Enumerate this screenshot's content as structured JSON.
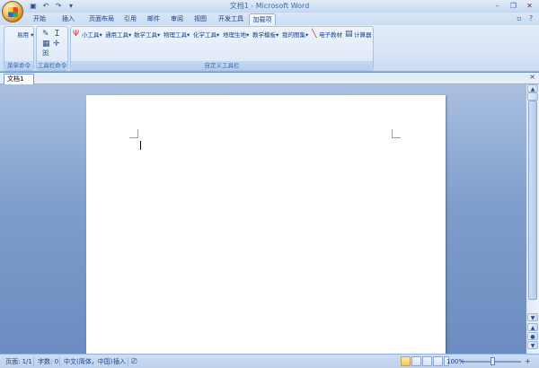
{
  "titlebar": {
    "title": "文档1 - Microsoft Word",
    "qat": {
      "save_icon": "▣",
      "undo_icon": "↶",
      "redo_icon": "↷",
      "customize_icon": "▾"
    },
    "controls": {
      "minimize": "–",
      "restore": "❐",
      "close": "✕"
    }
  },
  "ribbon_tabs": {
    "tabs": [
      "开始",
      "插入",
      "页面布局",
      "引用",
      "邮件",
      "审阅",
      "视图",
      "开发工具",
      "加载项"
    ],
    "active": "加载项",
    "right": {
      "minimize_ribbon": "▫",
      "help": "?"
    }
  },
  "ribbon": {
    "groups": {
      "menu_commands": {
        "label": "菜单命令",
        "item": "易用"
      },
      "toolbar_commands": {
        "label": "工具栏命令"
      },
      "custom_toolbars": {
        "label": "自定义工具栏",
        "items": [
          "小工具",
          "通用工具",
          "数学工具",
          "物理工具",
          "化学工具",
          "地理生地",
          "教学模板",
          "我的图集"
        ],
        "e_textbook": "电子教材",
        "calculator": "计算器"
      }
    }
  },
  "doc_tabs": {
    "active": "文档1",
    "close": "×"
  },
  "statusbar": {
    "page": "页面: 1/1",
    "words": "字数: 0",
    "language": "中文(简体，中国)",
    "mode": "插入",
    "zoom": "100%",
    "zoom_out": "−",
    "zoom_in": "+"
  },
  "scrollbar": {
    "up": "▲",
    "down": "▼",
    "prev_page": "▲",
    "browse": "●",
    "next_page": "▼"
  },
  "colors": {
    "accent": "#15428b",
    "ribbon": "#dbe7f7",
    "workspace": "#7f9ecd"
  }
}
